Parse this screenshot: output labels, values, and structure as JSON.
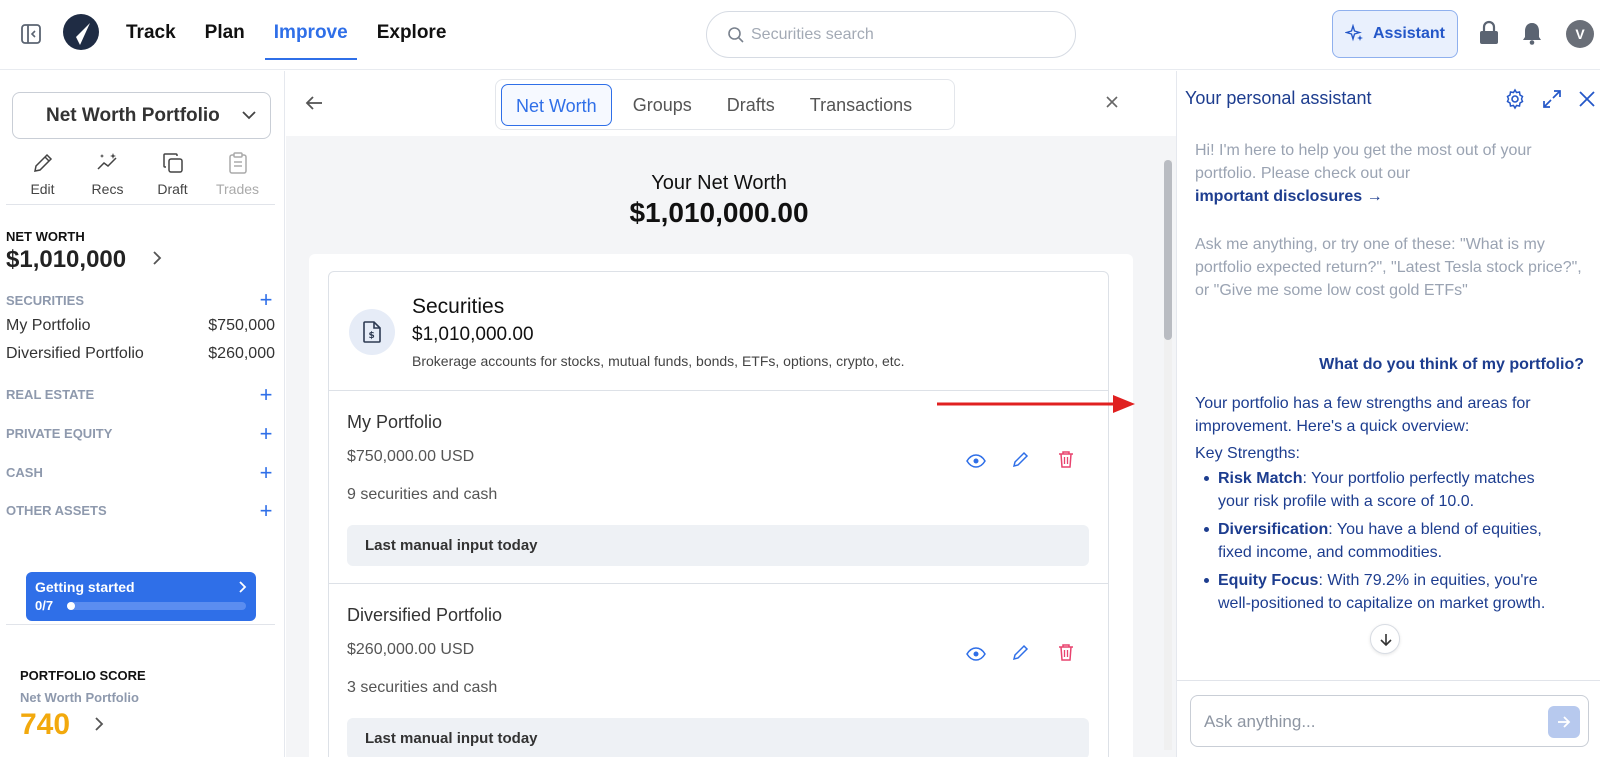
{
  "topbar": {
    "nav": [
      "Track",
      "Plan",
      "Improve",
      "Explore"
    ],
    "active_nav": "Improve",
    "search_placeholder": "Securities search",
    "assistant_label": "Assistant",
    "avatar_initial": "V",
    "accent_color": "#2f6fe8"
  },
  "sidebar": {
    "portfolio_select": "Net Worth Portfolio",
    "tools": [
      {
        "label": "Edit",
        "icon": "pencil-icon",
        "enabled": true
      },
      {
        "label": "Recs",
        "icon": "sparkle-chart-icon",
        "enabled": true
      },
      {
        "label": "Draft",
        "icon": "copy-icon",
        "enabled": true
      },
      {
        "label": "Trades",
        "icon": "clipboard-icon",
        "enabled": false
      }
    ],
    "net_worth_label": "NET WORTH",
    "net_worth_value": "$1,010,000",
    "sections": {
      "securities": "SECURITIES",
      "real_estate": "REAL ESTATE",
      "private_equity": "PRIVATE EQUITY",
      "cash": "CASH",
      "other_assets": "OTHER ASSETS"
    },
    "securities_accounts": [
      {
        "name": "My Portfolio",
        "value": "$750,000"
      },
      {
        "name": "Diversified Portfolio",
        "value": "$260,000"
      }
    ],
    "getting_started": {
      "title": "Getting started",
      "count": "0/7",
      "progress": 0.0
    },
    "portfolio_score": {
      "label": "PORTFOLIO SCORE",
      "portfolio": "Net Worth Portfolio",
      "score": "740",
      "score_color": "#f2a90d"
    }
  },
  "center": {
    "tabs": [
      "Net Worth",
      "Groups",
      "Drafts",
      "Transactions"
    ],
    "active_tab": "Net Worth",
    "title": "Your Net Worth",
    "value": "$1,010,000.00",
    "card": {
      "title": "Securities",
      "value": "$1,010,000.00",
      "description": "Brokerage accounts for stocks, mutual funds, bonds, ETFs, options, crypto, etc.",
      "accounts": [
        {
          "name": "My Portfolio",
          "usd": "$750,000.00 USD",
          "count": "9 securities and cash",
          "manual": "Last manual input today"
        },
        {
          "name": "Diversified Portfolio",
          "usd": "$260,000.00 USD",
          "count": "3 securities and cash",
          "manual": "Last manual input today"
        }
      ]
    }
  },
  "assistant": {
    "title": "Your personal assistant",
    "intro_1": "Hi! I'm here to help you get the most out of your portfolio. Please check out our",
    "disclosures_link": "important disclosures →",
    "intro_2": "Ask me anything, or try one of these: \"What is my portfolio expected return?\", \"Latest Tesla stock price?\", or \"Give me some low cost gold ETFs\"",
    "user_question": "What do you think of my portfolio?",
    "answer_intro": "Your portfolio has a few strengths and areas for improvement. Here's a quick overview:",
    "key_strengths_label": "Key Strengths:",
    "strengths": [
      {
        "bold": "Risk Match",
        "text": ": Your portfolio perfectly matches your risk profile with a score of 10.0."
      },
      {
        "bold": "Diversification",
        "text": ": You have a blend of equities, fixed income, and commodities."
      },
      {
        "bold": "Equity Focus",
        "text": ": With 79.2% in equities, you're well-positioned to capitalize on market growth."
      }
    ],
    "ask_placeholder": "Ask anything..."
  }
}
